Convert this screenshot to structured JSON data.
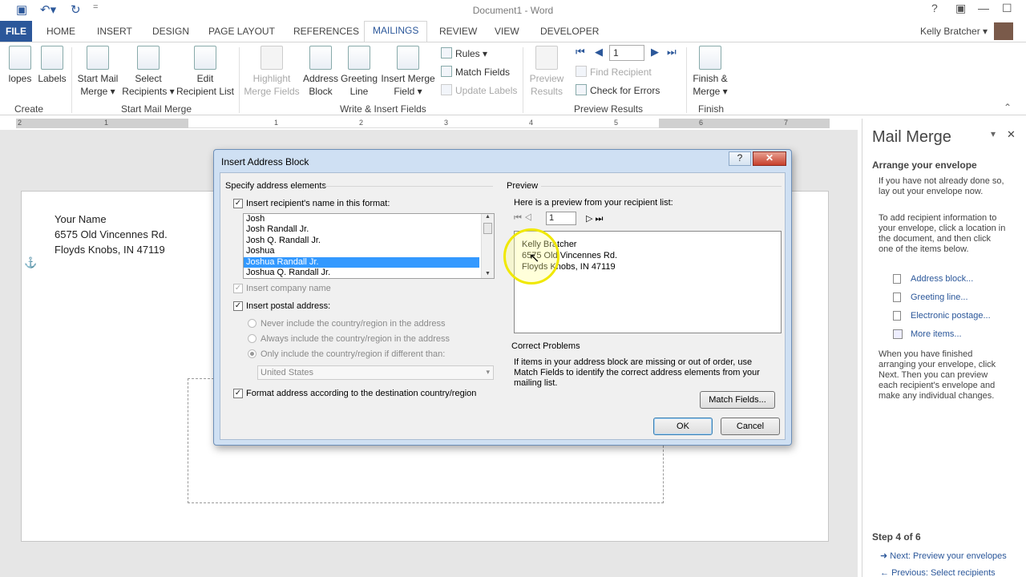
{
  "app": {
    "title": "Document1 - Word",
    "user": "Kelly Bratcher"
  },
  "tabs": [
    "FILE",
    "HOME",
    "INSERT",
    "DESIGN",
    "PAGE LAYOUT",
    "REFERENCES",
    "MAILINGS",
    "REVIEW",
    "VIEW",
    "DEVELOPER"
  ],
  "ribbon": {
    "create": {
      "envelopes": "lopes",
      "labels": "Labels",
      "group": "Create"
    },
    "start": {
      "start_mail_merge_1": "Start Mail",
      "start_mail_merge_2": "Merge ▾",
      "select_1": "Select",
      "select_2": "Recipients ▾",
      "edit_1": "Edit",
      "edit_2": "Recipient List",
      "group": "Start Mail Merge"
    },
    "write": {
      "highlight_1": "Highlight",
      "highlight_2": "Merge Fields",
      "address_1": "Address",
      "address_2": "Block",
      "greeting_1": "Greeting",
      "greeting_2": "Line",
      "insert_1": "Insert Merge",
      "insert_2": "Field ▾",
      "rules": "Rules ▾",
      "match": "Match Fields",
      "update": "Update Labels",
      "group": "Write & Insert Fields"
    },
    "preview": {
      "preview_1": "Preview",
      "preview_2": "Results",
      "record": "1",
      "find": "Find Recipient",
      "check": "Check for Errors",
      "group": "Preview Results"
    },
    "finish": {
      "finish_1": "Finish &",
      "finish_2": "Merge ▾",
      "group": "Finish"
    }
  },
  "ruler": {
    "numbers": [
      "2",
      "1",
      "1",
      "2",
      "3",
      "4",
      "5",
      "6",
      "7"
    ]
  },
  "document": {
    "line1": "Your Name",
    "line2": "6575 Old Vincennes Rd.",
    "line3": "Floyds Knobs, IN 47119"
  },
  "pane": {
    "title": "Mail Merge",
    "heading": "Arrange your envelope",
    "p1": "If you have not already done so, lay out your envelope now.",
    "p2": "To add recipient information to your envelope, click a location in the document, and then click one of the items below.",
    "links": [
      "Address block...",
      "Greeting line...",
      "Electronic postage...",
      "More items..."
    ],
    "p3": "When you have finished arranging your envelope, click Next. Then you can preview each recipient's envelope and make any individual changes.",
    "step": "Step 4 of 6",
    "next": "Next: Preview your envelopes",
    "prev": "Previous: Select recipients"
  },
  "dialog": {
    "title": "Insert Address Block",
    "help": "?",
    "close": "✕",
    "specify": "Specify address elements",
    "insert_name": "Insert recipient's name in this format:",
    "names": [
      "Josh",
      "Josh Randall Jr.",
      "Josh Q. Randall Jr.",
      "Joshua",
      "Joshua Randall Jr.",
      "Joshua Q. Randall Jr."
    ],
    "selected_index": 4,
    "company": "Insert company name",
    "postal": "Insert postal address:",
    "never": "Never include the country/region in the address",
    "always": "Always include the country/region in the address",
    "only": "Only include the country/region if different than:",
    "country": "United States",
    "format": "Format address according to the destination country/region",
    "preview_label": "Preview",
    "preview_hint": "Here is a preview from your recipient list:",
    "preview_record": "1",
    "preview_lines": [
      "Kelly Bratcher",
      "6575 Old Vincennes Rd.",
      "Floyds Knobs, IN 47119"
    ],
    "correct": "Correct Problems",
    "correct_text": "If items in your address block are missing or out of order, use Match Fields to identify the correct address elements from your mailing list.",
    "match_button": "Match Fields...",
    "ok": "OK",
    "cancel": "Cancel"
  }
}
